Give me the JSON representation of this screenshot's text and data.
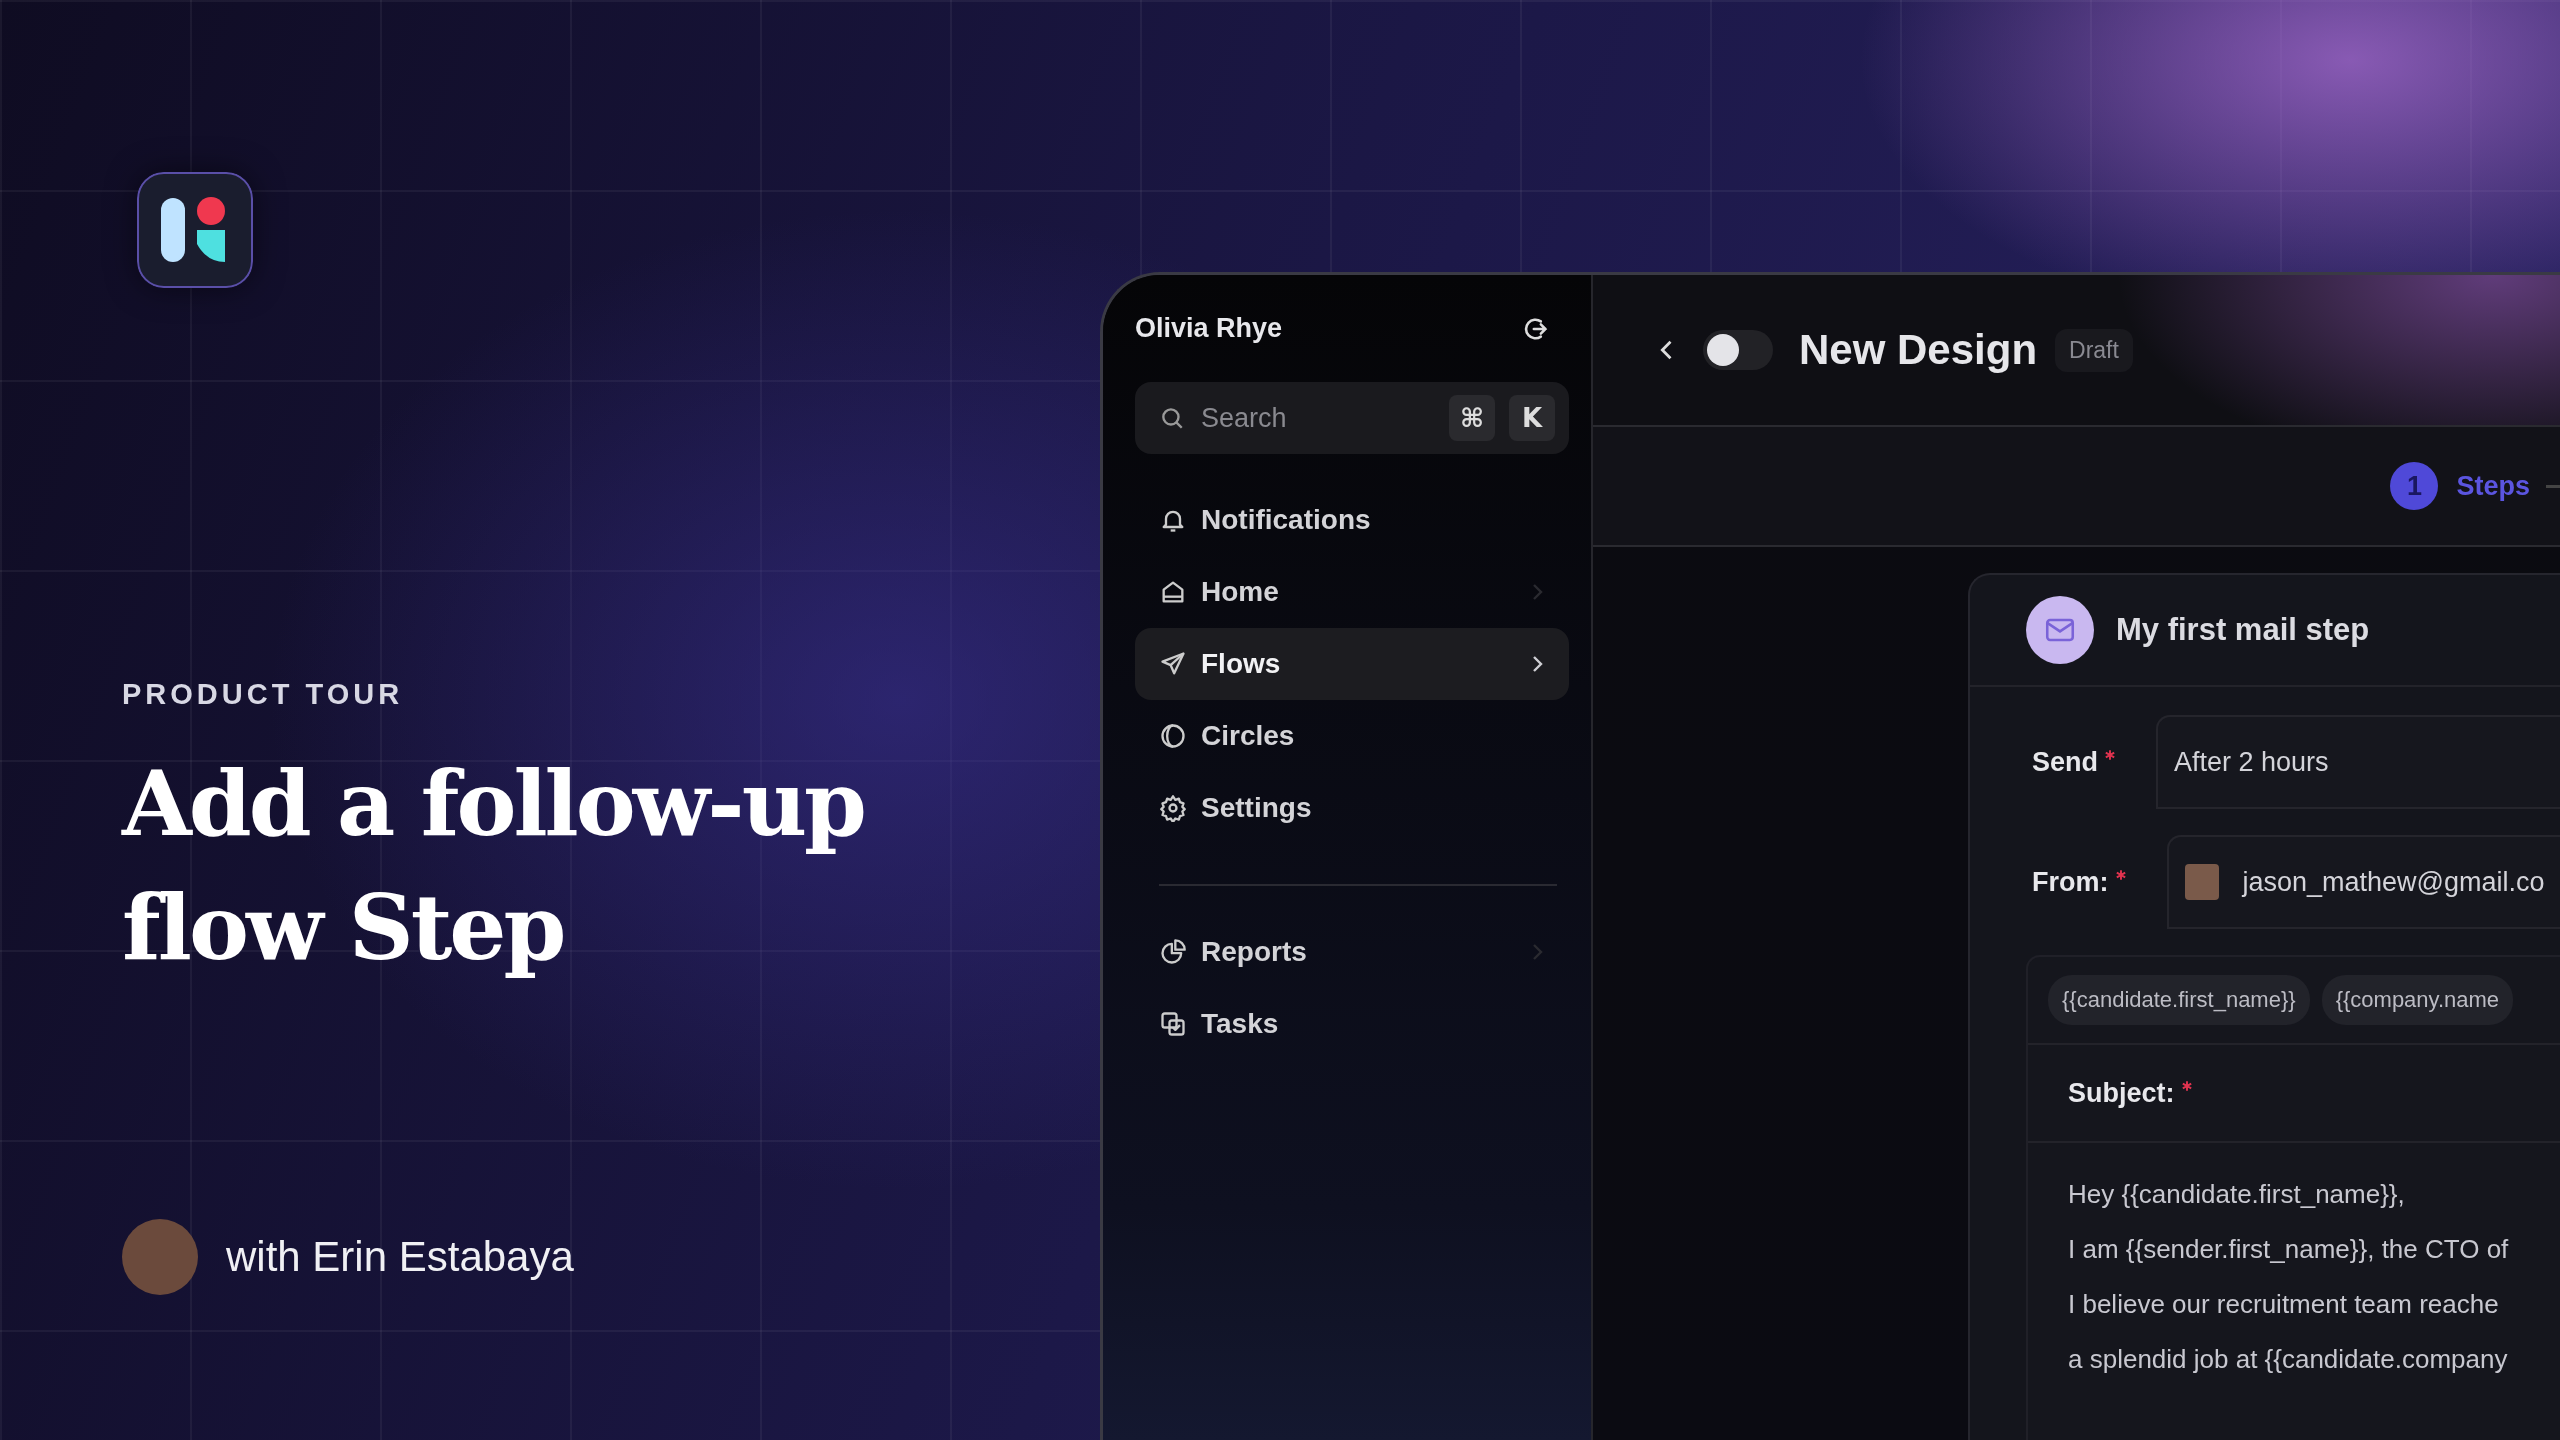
{
  "tour": {
    "eyebrow": "PRODUCT TOUR",
    "title_lines": [
      "Add a follow-up",
      "flow Step"
    ],
    "presenter": "with Erin Estabaya"
  },
  "sidebar": {
    "user": "Olivia Rhye",
    "search": {
      "placeholder": "Search",
      "keys": [
        "⌘",
        "K"
      ]
    },
    "items": [
      {
        "label": "Notifications",
        "selected": false,
        "chevron": false
      },
      {
        "label": "Home",
        "selected": false,
        "chevron": true
      },
      {
        "label": "Flows",
        "selected": true,
        "chevron": true
      },
      {
        "label": "Circles",
        "selected": false,
        "chevron": false
      },
      {
        "label": "Settings",
        "selected": false,
        "chevron": false
      }
    ],
    "secondary_items": [
      {
        "label": "Reports",
        "selected": false,
        "chevron": true
      },
      {
        "label": "Tasks",
        "selected": false,
        "chevron": false
      }
    ]
  },
  "header": {
    "title": "New Design",
    "badge": "Draft",
    "toggle": {
      "on": false
    }
  },
  "stepper": [
    {
      "number": "1",
      "label": "Steps",
      "selected": true
    }
  ],
  "card": {
    "title": "My first mail step",
    "fields": [
      {
        "kind": "text",
        "label": "Send",
        "required": true,
        "value": "After 2 hours"
      },
      {
        "kind": "sender",
        "label": "From:",
        "required": true,
        "value": "jason_mathew@gmail.co"
      }
    ],
    "tags": [
      "{{candidate.first_name}}",
      "{{company.name"
    ],
    "subject": {
      "label": "Subject:",
      "required": true
    },
    "body_lines": [
      "Hey {{candidate.first_name}},",
      "I am {{sender.first_name}}, the CTO of",
      "I believe our recruitment team reache",
      "a splendid job at {{candidate.company"
    ]
  }
}
